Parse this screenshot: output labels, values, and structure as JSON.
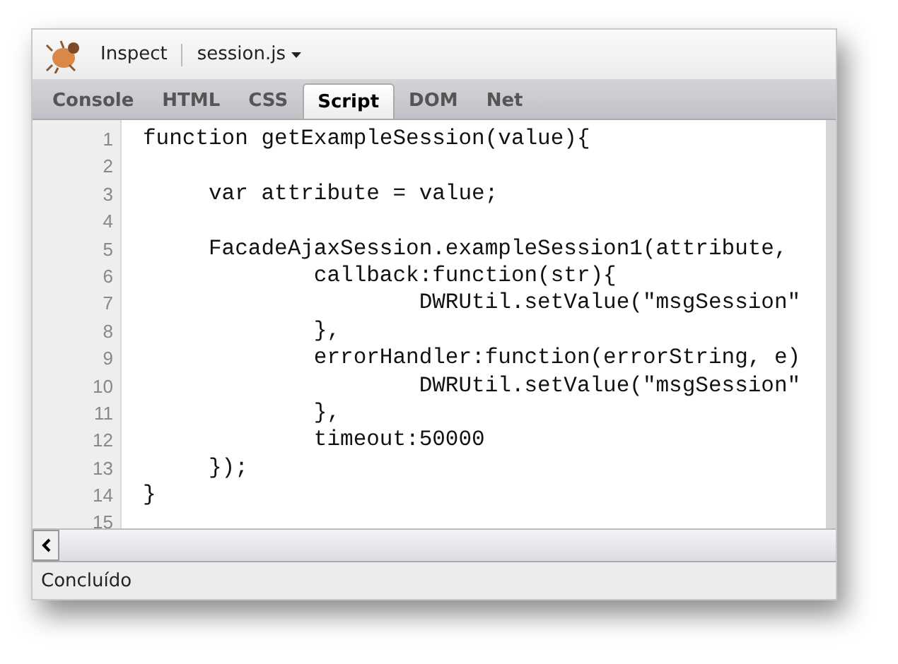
{
  "toolbar": {
    "inspect": "Inspect",
    "file": "session.js"
  },
  "tabs": [
    {
      "label": "Console",
      "selected": false
    },
    {
      "label": "HTML",
      "selected": false
    },
    {
      "label": "CSS",
      "selected": false
    },
    {
      "label": "Script",
      "selected": true
    },
    {
      "label": "DOM",
      "selected": false
    },
    {
      "label": "Net",
      "selected": false
    }
  ],
  "code_lines": [
    {
      "number": "1",
      "text": "function getExampleSession(value){"
    },
    {
      "number": "2"
    },
    {
      "number": "3",
      "text": "     var attribute = value;"
    },
    {
      "number": "4"
    },
    {
      "number": "5",
      "text": "     FacadeAjaxSession.exampleSession1(attribute,"
    },
    {
      "number": "6",
      "text": "             callback:function(str){"
    },
    {
      "number": "7",
      "text": "                     DWRUtil.setValue(\"msgSession\""
    },
    {
      "number": "8",
      "text": "             },"
    },
    {
      "number": "9",
      "text": "             errorHandler:function(errorString, e)"
    },
    {
      "number": "10",
      "text": "                     DWRUtil.setValue(\"msgSession\""
    },
    {
      "number": "11",
      "text": "             },"
    },
    {
      "number": "12",
      "text": "             timeout:50000"
    },
    {
      "number": "13",
      "text": "     });"
    },
    {
      "number": "14",
      "text": "}"
    },
    {
      "number": "15"
    }
  ],
  "status_bar": "Concluído"
}
